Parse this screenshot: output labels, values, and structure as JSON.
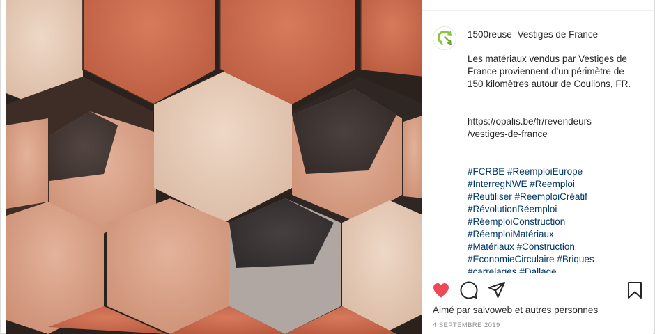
{
  "post": {
    "username": "1500reuse",
    "title": "Vestiges de France",
    "description": "Les matériaux vendus par Vestiges de France proviennent d'un périmètre de 150 kilomètres autour de Coullons, FR.",
    "link_line1": "https://opalis.be/fr/revendeurs",
    "link_line2": "/vestiges-de-france",
    "hashtag_lines": [
      [
        "#FCRBE",
        "#ReemploiEurope"
      ],
      [
        "#InterregNWE",
        "#Reemploi"
      ],
      [
        "#Reutiliser",
        "#ReemploiCréatif"
      ],
      [
        "#RévolutionRéemploi"
      ],
      [
        "#RéemploiConstruction"
      ],
      [
        "#RéemploiMatériaux"
      ],
      [
        "#Matériaux",
        "#Construction"
      ],
      [
        "#EconomieCirculaire",
        "#Briques"
      ],
      [
        "#carrelages",
        "#Dallage"
      ]
    ]
  },
  "likes": {
    "prefix": "Aimé par",
    "user": "salvoweb",
    "connector": "et",
    "others": "autres personnes"
  },
  "date": "4 septembre 2019",
  "colors": {
    "like_heart": "#ed4956",
    "hashtag": "#00376b",
    "avatar_green": "#8cc63f"
  },
  "icons": {
    "like": "heart-icon",
    "comment": "comment-icon",
    "share": "paper-plane-icon",
    "save": "bookmark-icon",
    "avatar": "recycle-logo"
  }
}
